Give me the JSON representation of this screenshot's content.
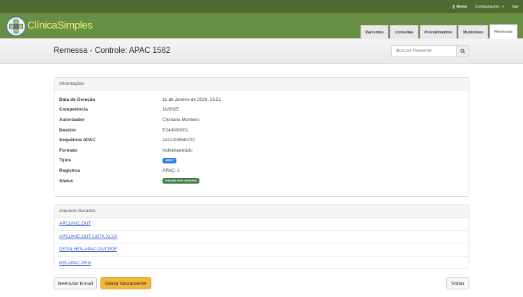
{
  "topbar": {
    "user_label": "Demo",
    "config_label": "Configurações",
    "logout_label": "Sair"
  },
  "brand": {
    "name": "ClínicaSimples",
    "logo_icon": "medical-cross-logo"
  },
  "nav": {
    "tabs": [
      {
        "label": "Pacientes",
        "active": false
      },
      {
        "label": "Consultas",
        "active": false
      },
      {
        "label": "Procedimentos",
        "active": false
      },
      {
        "label": "Municípios",
        "active": false
      },
      {
        "label": "Remessas",
        "active": true
      }
    ]
  },
  "header": {
    "title": "Remessa - Controle: APAC 1582",
    "search_placeholder": "Buscar Paciente",
    "search_icon": "search-icon"
  },
  "info": {
    "heading": "Informações",
    "rows": [
      {
        "label": "Data de Geração",
        "value": "11 de Janeiro de 2026, 15:51"
      },
      {
        "label": "Competência",
        "value": "10/2025"
      },
      {
        "label": "Autorizador",
        "value": "Cristiano Monteiro"
      },
      {
        "label": "Destino",
        "value": "E240000001"
      },
      {
        "label": "Sequência APAC",
        "value": "2412209580737"
      },
      {
        "label": "Formato",
        "value": "Individualizado"
      },
      {
        "label": "Tipos",
        "badge": "APAC"
      },
      {
        "label": "Registros",
        "value": "APAC: 1"
      },
      {
        "label": "Status",
        "badge": "Gerada com sucesso"
      }
    ]
  },
  "files": {
    "heading": "Arquivos Gerados",
    "items": [
      "APCLINIC.OUT",
      "APCLINIC.OUT-LISTA.XLSX",
      "DETALHES-APAC.OUT.PDF",
      "RELAPAC.PRN"
    ]
  },
  "actions": {
    "resend_label": "Reenviar Email",
    "regenerate_label": "Gerar Novamente",
    "back_label": "Voltar"
  },
  "colors": {
    "topbar": "#4e6b31",
    "band": "#678f45",
    "brand_text": "#ecf277",
    "badge_blue": "#2e7cd6",
    "badge_green": "#3b7d45",
    "button_yellow": "#f0b73e"
  }
}
